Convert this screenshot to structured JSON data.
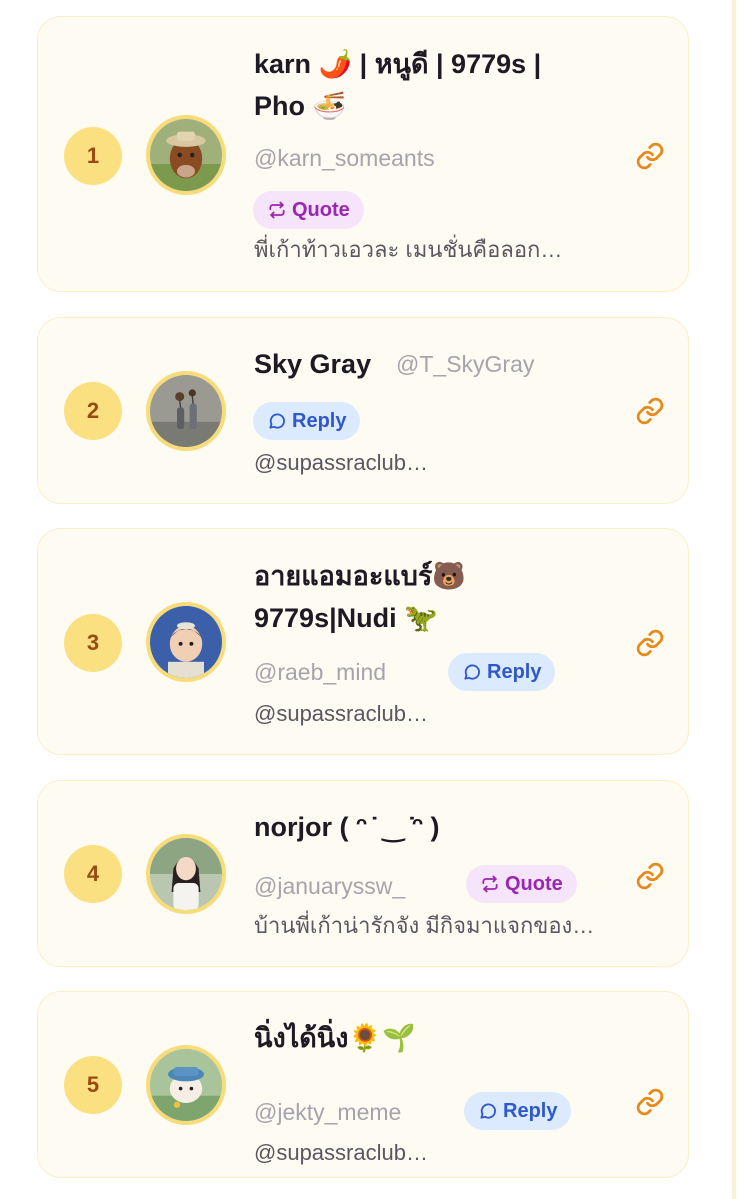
{
  "colors": {
    "card_bg": "#fdfbf2",
    "card_border": "#fbefc8",
    "rank_bg": "#fbe081",
    "rank_text": "#9a4a10",
    "avatar_ring": "#f9dc7a",
    "quote_bg": "#f6e4fa",
    "quote_text": "#9b27b0",
    "reply_bg": "#dbeafe",
    "reply_text": "#2f58c9",
    "link_icon": "#e8891b"
  },
  "entries": [
    {
      "rank": "1",
      "name_line1": "karn 🌶️ | หนูดี | 9779s |",
      "name_line2": "Pho 🍜",
      "handle": "@karn_someants",
      "badge": "Quote",
      "badge_icon": "repost-icon",
      "snippet": "พี่เก้าท้าวเอวละ เมนชั่นคือลอก…"
    },
    {
      "rank": "2",
      "name_line1": "Sky Gray",
      "handle": "@T_SkyGray",
      "badge": "Reply",
      "badge_icon": "chat-bubble-icon",
      "snippet": "@supassraclub…"
    },
    {
      "rank": "3",
      "name_line1": "อายแอมอะแบร์🐻",
      "name_line2": "9779s|Nudi 🦖",
      "handle": "@raeb_mind",
      "badge": "Reply",
      "badge_icon": "chat-bubble-icon",
      "snippet": "@supassraclub…"
    },
    {
      "rank": "4",
      "name_line1": "norjor ( ᵔ ̇ ‿ ̇ᵔ )",
      "handle": "@januaryssw_",
      "badge": "Quote",
      "badge_icon": "repost-icon",
      "snippet": "บ้านพี่เก้าน่ารักจัง มีกิจมาแจกของ…"
    },
    {
      "rank": "5",
      "name_line1": "นิ่งได้นิ่ง🌻🌱",
      "handle": "@jekty_meme",
      "badge": "Reply",
      "badge_icon": "chat-bubble-icon",
      "snippet": "@supassraclub…"
    }
  ]
}
